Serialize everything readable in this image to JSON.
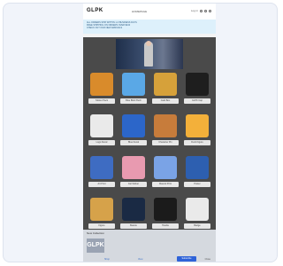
{
  "window": {
    "logo": "GLPK",
    "page_title": "HOMEPAGE",
    "top_right_text": "Log in",
    "icons": [
      "search-icon",
      "user-icon",
      "cart-icon"
    ]
  },
  "notice": {
    "lines": [
      "ALL ORDERS SHIP WITHIN 1-3 BUSINESS DAYS",
      "FREE SHIPPING ON ORDERS OVER $100",
      "CHECK OUT OUR NEW ARRIVALS"
    ]
  },
  "hero": {
    "alt": "featured banner"
  },
  "products": [
    {
      "label": "Sticker Pack",
      "color": "#d98b2b"
    },
    {
      "label": "Blue Blob Plush",
      "color": "#5aa8e6"
    },
    {
      "label": "Card Box",
      "color": "#d6a13a"
    },
    {
      "label": "GLPK Cap",
      "color": "#1e1e1e"
    },
    {
      "label": "Logo Decal",
      "color": "#eaeaea"
    },
    {
      "label": "Blue Decal",
      "color": "#2c66c9"
    },
    {
      "label": "Character Pin",
      "color": "#c77c3b"
    },
    {
      "label": "Duck Figure",
      "color": "#f3b03a"
    },
    {
      "label": "Art Print",
      "color": "#3e6cc2"
    },
    {
      "label": "Cat Sticker",
      "color": "#e89ab0"
    },
    {
      "label": "Mascot Print",
      "color": "#7aa3e6"
    },
    {
      "label": "Poster",
      "color": "#2d5fb0"
    },
    {
      "label": "Figure",
      "color": "#d6a24a"
    },
    {
      "label": "Beanie",
      "color": "#1a2a44"
    },
    {
      "label": "Hoodie",
      "color": "#1b1b1b"
    },
    {
      "label": "Badge",
      "color": "#eaeaea"
    }
  ],
  "overlay": {
    "title": "New Collection",
    "logo_text": "GLPK",
    "link1": "Shop",
    "link2": "View",
    "button": "Subscribe",
    "small": "Close"
  }
}
